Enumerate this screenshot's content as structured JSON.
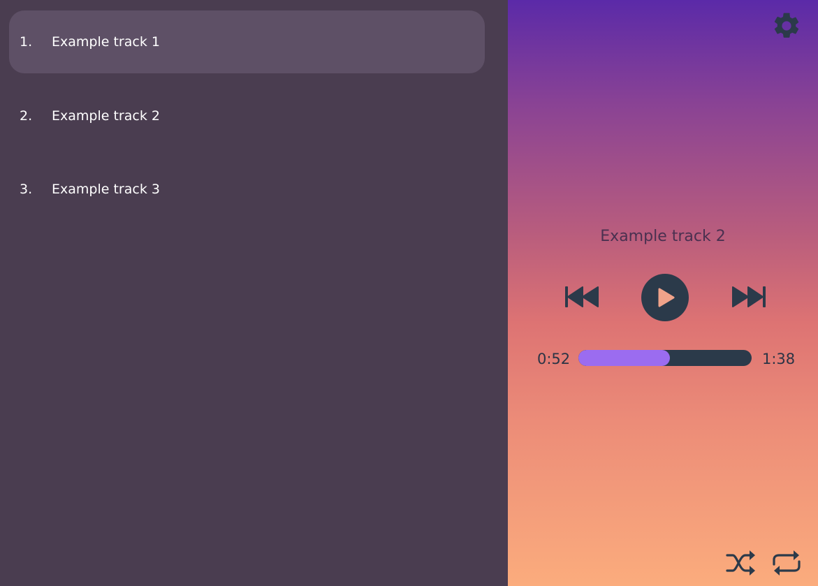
{
  "playlist": {
    "tracks": [
      {
        "number": "1.",
        "title": "Example track 1",
        "active": true
      },
      {
        "number": "2.",
        "title": "Example track 2",
        "active": false
      },
      {
        "number": "3.",
        "title": "Example track 3",
        "active": false
      }
    ]
  },
  "player": {
    "now_playing": "Example track 2",
    "current_time": "0:52",
    "total_time": "1:38",
    "progress_fraction": 0.53,
    "icons": {
      "settings": "gear-icon",
      "previous": "skip-back-icon",
      "play": "play-icon",
      "next": "skip-forward-icon",
      "shuffle": "shuffle-icon",
      "repeat": "repeat-icon"
    }
  },
  "colors": {
    "sidebar_bg": "#4a3d50",
    "active_track_bg": "#5e5066",
    "icon_dark": "#2b3a4a",
    "progress_fill": "#9b6cf0"
  }
}
